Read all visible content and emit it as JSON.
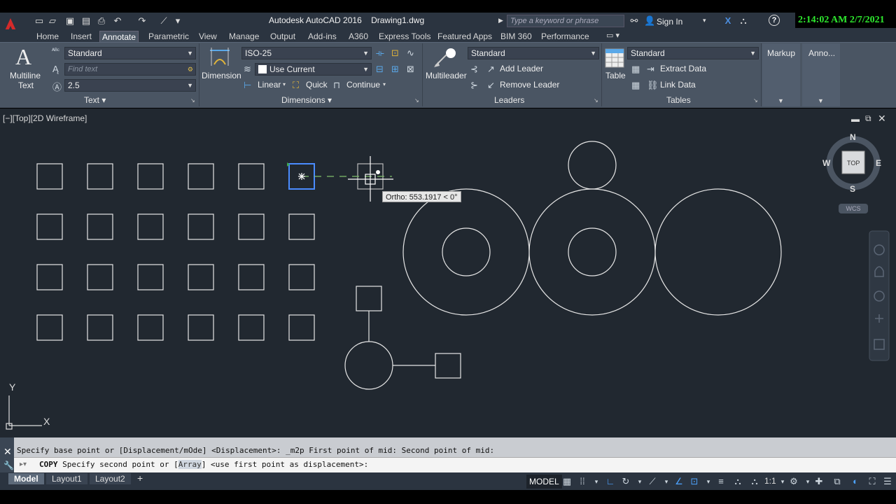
{
  "window": {
    "title": "Autodesk AutoCAD 2016    Drawing1.dwg",
    "search_placeholder": "Type a keyword or phrase",
    "sign_in": "Sign In",
    "help": "?",
    "clock": "2:14:02 AM 2/7/2021"
  },
  "tabs": [
    "Home",
    "Insert",
    "Annotate",
    "Parametric",
    "View",
    "Manage",
    "Output",
    "Add-ins",
    "A360",
    "Express Tools",
    "Featured Apps",
    "BIM 360",
    "Performance"
  ],
  "active_tab": "Annotate",
  "ribbon": {
    "text_panel": {
      "label": "Text",
      "multiline_line1": "Multiline",
      "multiline_line2": "Text",
      "style": "Standard",
      "find_placeholder": "Find text",
      "height": "2.5"
    },
    "dimensions_panel": {
      "label": "Dimensions",
      "dimension": "Dimension",
      "style": "ISO-25",
      "layer": "Use Current",
      "linear": "Linear",
      "quick": "Quick",
      "continue": "Continue"
    },
    "leaders_panel": {
      "label": "Leaders",
      "multileader": "Multileader",
      "style": "Standard",
      "add_leader": "Add Leader",
      "remove_leader": "Remove Leader"
    },
    "tables_panel": {
      "label": "Tables",
      "table": "Table",
      "style": "Standard",
      "extract_data": "Extract Data",
      "link_data": "Link Data"
    },
    "markup": "Markup",
    "anno": "Anno..."
  },
  "viewport": {
    "label": "[−][Top][2D Wireframe]",
    "ortho_tooltip": "Ortho: 553.1917 < 0°",
    "viewcube": {
      "n": "N",
      "s": "S",
      "e": "E",
      "w": "W",
      "top": "TOP",
      "wcs": "WCS"
    },
    "ucs_x": "X",
    "ucs_y": "Y"
  },
  "command": {
    "history": "Specify base point or [Displacement/mOde] <Displacement>: _m2p First point of mid: Second point of mid:",
    "prompt_cmd": "COPY",
    "prompt_pre": " Specify second point or [",
    "prompt_option": "Array",
    "prompt_post": "] <use first point as displacement>:"
  },
  "status": {
    "layouts": [
      "Model",
      "Layout1",
      "Layout2"
    ],
    "add_layout": "+",
    "model": "MODEL",
    "scale": "1:1"
  },
  "colors": {
    "canvas": "#212830",
    "ribbon": "#4a5563",
    "clock": "#2ee82e",
    "selected": "#4a8cff"
  }
}
